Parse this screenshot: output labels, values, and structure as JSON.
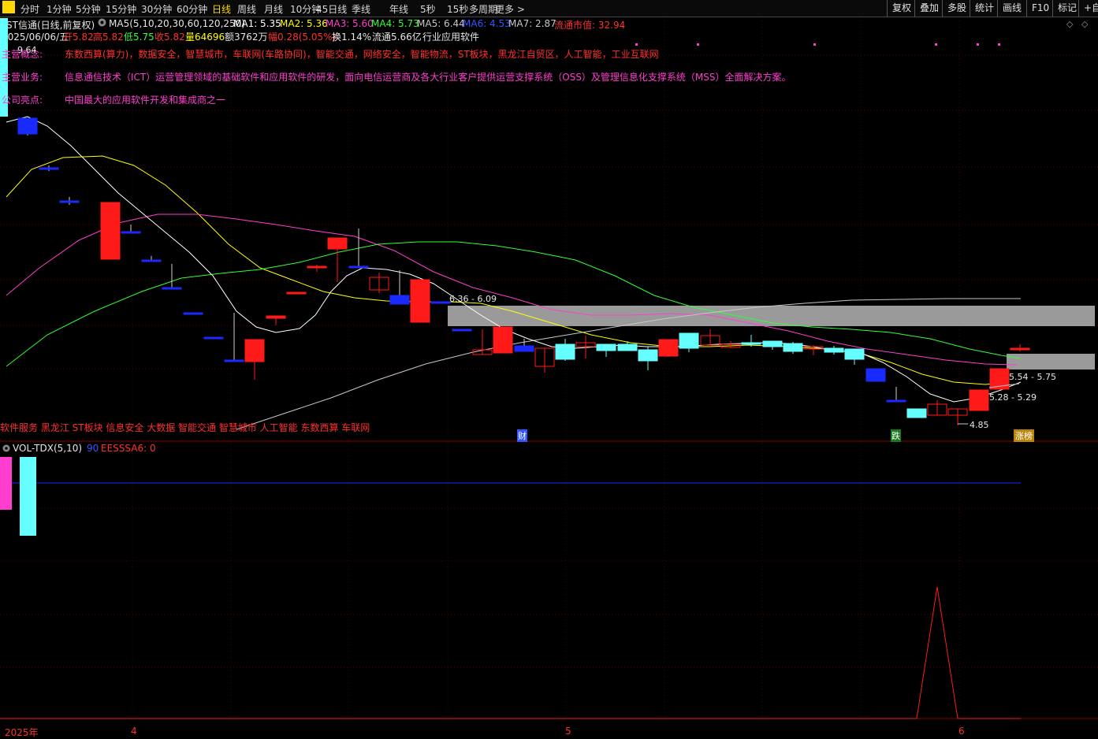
{
  "toolbar": {
    "periods": [
      "分时",
      "1分钟",
      "5分钟",
      "15分钟",
      "30分钟",
      "60分钟",
      "日线",
      "周线",
      "月线",
      "10分钟",
      "45日线",
      "季线",
      "年线",
      "5秒",
      "15秒",
      "多周期",
      "更多 >"
    ],
    "active_period": "日线",
    "right_buttons": [
      "复权",
      "叠加",
      "多股",
      "统计",
      "画线",
      "F10",
      "标记",
      "+自"
    ]
  },
  "header": {
    "stock_title": "*ST信通(日线,前复权)",
    "ma_params": "MA5(5,10,20,30,60,120,250)",
    "ma_values": [
      {
        "label": "MA1: 5.35",
        "color": "#ffffff"
      },
      {
        "label": "MA2: 5.36",
        "color": "#ffff00"
      },
      {
        "label": "MA3: 5.60",
        "color": "#ff3ecf"
      },
      {
        "label": "MA4: 5.73",
        "color": "#33ff33"
      },
      {
        "label": "MA5: 6.44",
        "color": "#c8c8c8"
      },
      {
        "label": "MA6: 4.53",
        "color": "#3355ff"
      },
      {
        "label": "MA7: 2.87",
        "color": "#c8c8c8"
      }
    ],
    "float_mcap": "流通市值: 32.94",
    "date": "2025/06/06/五",
    "open": "开5.82",
    "high": "高5.82",
    "low": "低5.75",
    "close": "收5.82",
    "volume": "量64696",
    "amount": "额3762万",
    "change": "幅0.28(5.05%)",
    "turnover": "换1.14%",
    "float_shares": "流通5.66亿",
    "industry": "行业应用软件"
  },
  "info": {
    "concept_label": "主营概念:",
    "concept_value": "东数西算(算力)，数据安全，智慧城市，车联网(车路协同)，智能交通，网络安全，智能物流，ST板块，黑龙江自贸区，人工智能，工业互联网",
    "business_label": "主营业务:",
    "business_value": "信息通信技术（ICT）运营管理领域的基础软件和应用软件的研发，面向电信运营商及各大行业客户提供运营支撑系统（OSS）及管理信息化支撑系统（MSS）全面解决方案。",
    "highlight_label": "公司亮点:",
    "highlight_value": "中国最大的应用软件开发和集成商之一"
  },
  "chart_labels": {
    "high_price": "9.64",
    "zone_upper": "6.36 - 6.09",
    "zone_mid": "5.54 - 5.75",
    "zone_low": "5.28 - 5.29",
    "low_price": "4.85",
    "tags_line": "软件服务 黑龙江 ST板块 信息安全 大数据 智能交通 智慧城市 人工智能 东数西算 车联网",
    "event_cai": "财",
    "event_die": "跌",
    "event_zhangbang": "涨榜"
  },
  "volume_panel": {
    "title": "VOL-TDX(5,10)",
    "value1": "90",
    "indicator": "EESSSA6: 0"
  },
  "time_axis": [
    "2025年",
    "4",
    "5",
    "6"
  ],
  "colors": {
    "up": "#ff1a1a",
    "down_blue": "#1a2aff",
    "down_cyan": "#66ffff",
    "ma1": "#ffffff",
    "ma2": "#ffff00",
    "ma3": "#ff3ecf",
    "ma4": "#33ff33",
    "zone": "#9a9a9a"
  }
}
